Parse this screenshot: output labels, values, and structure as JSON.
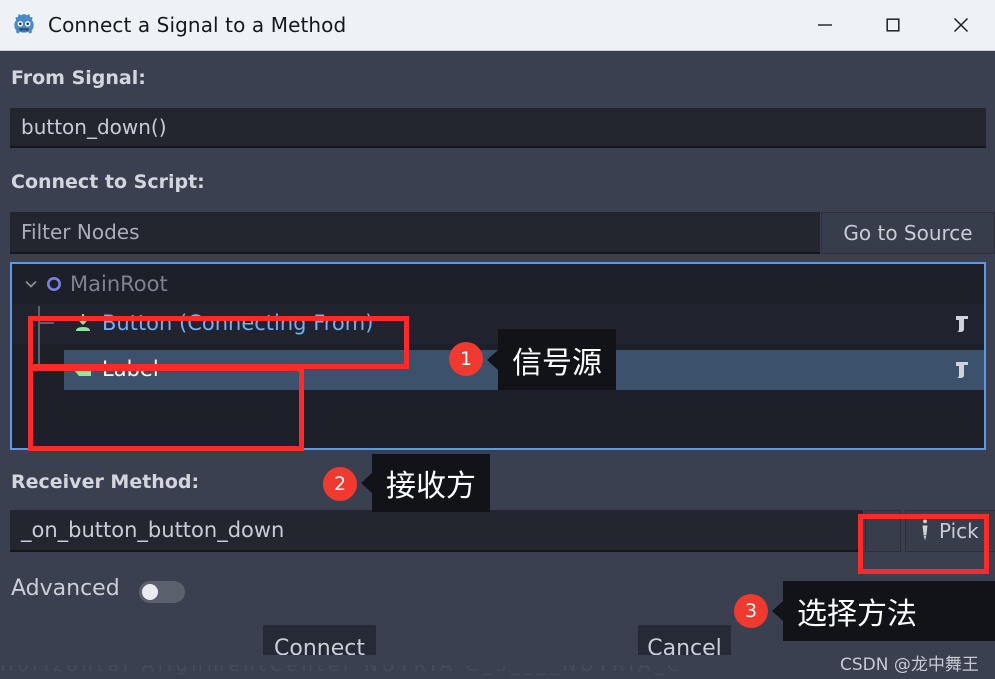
{
  "window": {
    "title": "Connect a Signal to a Method",
    "icon": "godot-robot-icon",
    "controls": {
      "minimize": "minimize-icon",
      "maximize": "maximize-icon",
      "close": "close-icon"
    }
  },
  "from_signal": {
    "label": "From Signal:",
    "value": "button_down()"
  },
  "connect_to_script": {
    "label": "Connect to Script:",
    "filter_placeholder": "Filter Nodes",
    "filter_value": "",
    "go_to_source_label": "Go to Source"
  },
  "tree": {
    "rows": [
      {
        "name": "MainRoot",
        "depth": 0,
        "icon": "node-control-icon",
        "state": "disabled",
        "expanded": true,
        "has_script": false
      },
      {
        "name": "Button (Connecting From)",
        "depth": 1,
        "icon": "button-node-icon",
        "state": "connecting-from",
        "has_script": true
      },
      {
        "name": "Label",
        "depth": 1,
        "icon": "label-node-icon",
        "state": "selected",
        "has_script": true
      }
    ]
  },
  "receiver_method": {
    "label": "Receiver Method:",
    "value": "_on_button_button_down",
    "pick_label": "Pick",
    "pick_icon": "pick-tool-icon"
  },
  "advanced": {
    "label": "Advanced",
    "enabled": false
  },
  "buttons": {
    "connect": "Connect",
    "cancel": "Cancel"
  },
  "annotations": [
    {
      "number": "1",
      "text": "信号源"
    },
    {
      "number": "2",
      "text": "接收方"
    },
    {
      "number": "3",
      "text": "选择方法"
    }
  ],
  "watermark": "CSDN @龙中舞王",
  "colors": {
    "accent_blue": "#5b9ae8",
    "annotation_red": "#f0392f",
    "node_green": "#8ee6a0",
    "selection": "#3c526c",
    "panel_bg": "#3a4050",
    "field_bg": "#23262f"
  }
}
